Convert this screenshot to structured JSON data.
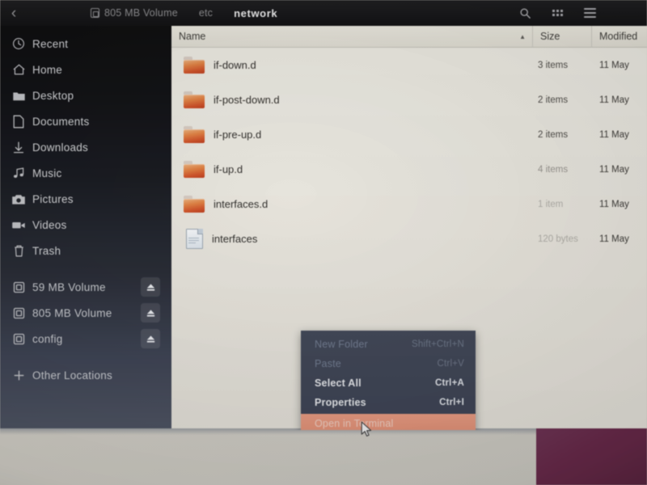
{
  "titlebar": {
    "back_icon": "chevron-left-icon",
    "breadcrumbs": [
      {
        "label": "805 MB Volume",
        "icon": "drive-icon",
        "current": false
      },
      {
        "label": "etc",
        "icon": "",
        "current": false
      },
      {
        "label": "network",
        "icon": "",
        "current": true
      }
    ],
    "actions": [
      {
        "name": "search-icon",
        "label": "Search"
      },
      {
        "name": "view-grid-icon",
        "label": "View options"
      },
      {
        "name": "hamburger-menu-icon",
        "label": "Menu"
      }
    ]
  },
  "sidebar": {
    "places": [
      {
        "label": "Recent",
        "icon": "clock-icon"
      },
      {
        "label": "Home",
        "icon": "home-icon"
      },
      {
        "label": "Desktop",
        "icon": "folder-icon"
      },
      {
        "label": "Documents",
        "icon": "document-icon"
      },
      {
        "label": "Downloads",
        "icon": "download-icon"
      },
      {
        "label": "Music",
        "icon": "music-note-icon"
      },
      {
        "label": "Pictures",
        "icon": "camera-icon"
      },
      {
        "label": "Videos",
        "icon": "video-camera-icon"
      },
      {
        "label": "Trash",
        "icon": "trash-icon"
      }
    ],
    "volumes": [
      {
        "label": "59 MB Volume",
        "icon": "drive-icon",
        "eject": true
      },
      {
        "label": "805 MB Volume",
        "icon": "drive-icon",
        "eject": true
      },
      {
        "label": "config",
        "icon": "drive-icon",
        "eject": true
      }
    ],
    "other": {
      "label": "Other Locations",
      "icon": "plus-icon"
    }
  },
  "filelist": {
    "columns": {
      "name": "Name",
      "size": "Size",
      "modified": "Modified"
    },
    "sort": {
      "column": "Name",
      "direction": "ascending",
      "glyph": "▲"
    },
    "rows": [
      {
        "name": "if-down.d",
        "icon": "folder-icon",
        "size": "3 items",
        "modified": "11 May"
      },
      {
        "name": "if-post-down.d",
        "icon": "folder-icon",
        "size": "2 items",
        "modified": "11 May"
      },
      {
        "name": "if-pre-up.d",
        "icon": "folder-icon",
        "size": "2 items",
        "modified": "11 May"
      },
      {
        "name": "if-up.d",
        "icon": "folder-icon",
        "size": "4 items",
        "modified": "11 May"
      },
      {
        "name": "interfaces.d",
        "icon": "folder-icon",
        "size": "1 item",
        "modified": "11 May"
      },
      {
        "name": "interfaces",
        "icon": "document-icon",
        "size": "120 bytes",
        "modified": "11 May"
      }
    ]
  },
  "context_menu": {
    "items": [
      {
        "label": "New Folder",
        "accel": "Shift+Ctrl+N",
        "state": "disabled"
      },
      {
        "label": "Paste",
        "accel": "Ctrl+V",
        "state": "disabled"
      },
      {
        "label": "Select All",
        "accel": "Ctrl+A",
        "state": "enabled"
      },
      {
        "label": "Properties",
        "accel": "Ctrl+I",
        "state": "enabled"
      },
      {
        "label": "Open in Terminal",
        "accel": "",
        "state": "highlighted"
      }
    ]
  },
  "colors": {
    "accent_highlight": "#e8937a",
    "folder_orange": "#e0702c",
    "menu_bg": "#3d4557",
    "sidebar_bottom": "#4a5162",
    "maroon_block": "#6b2248"
  }
}
